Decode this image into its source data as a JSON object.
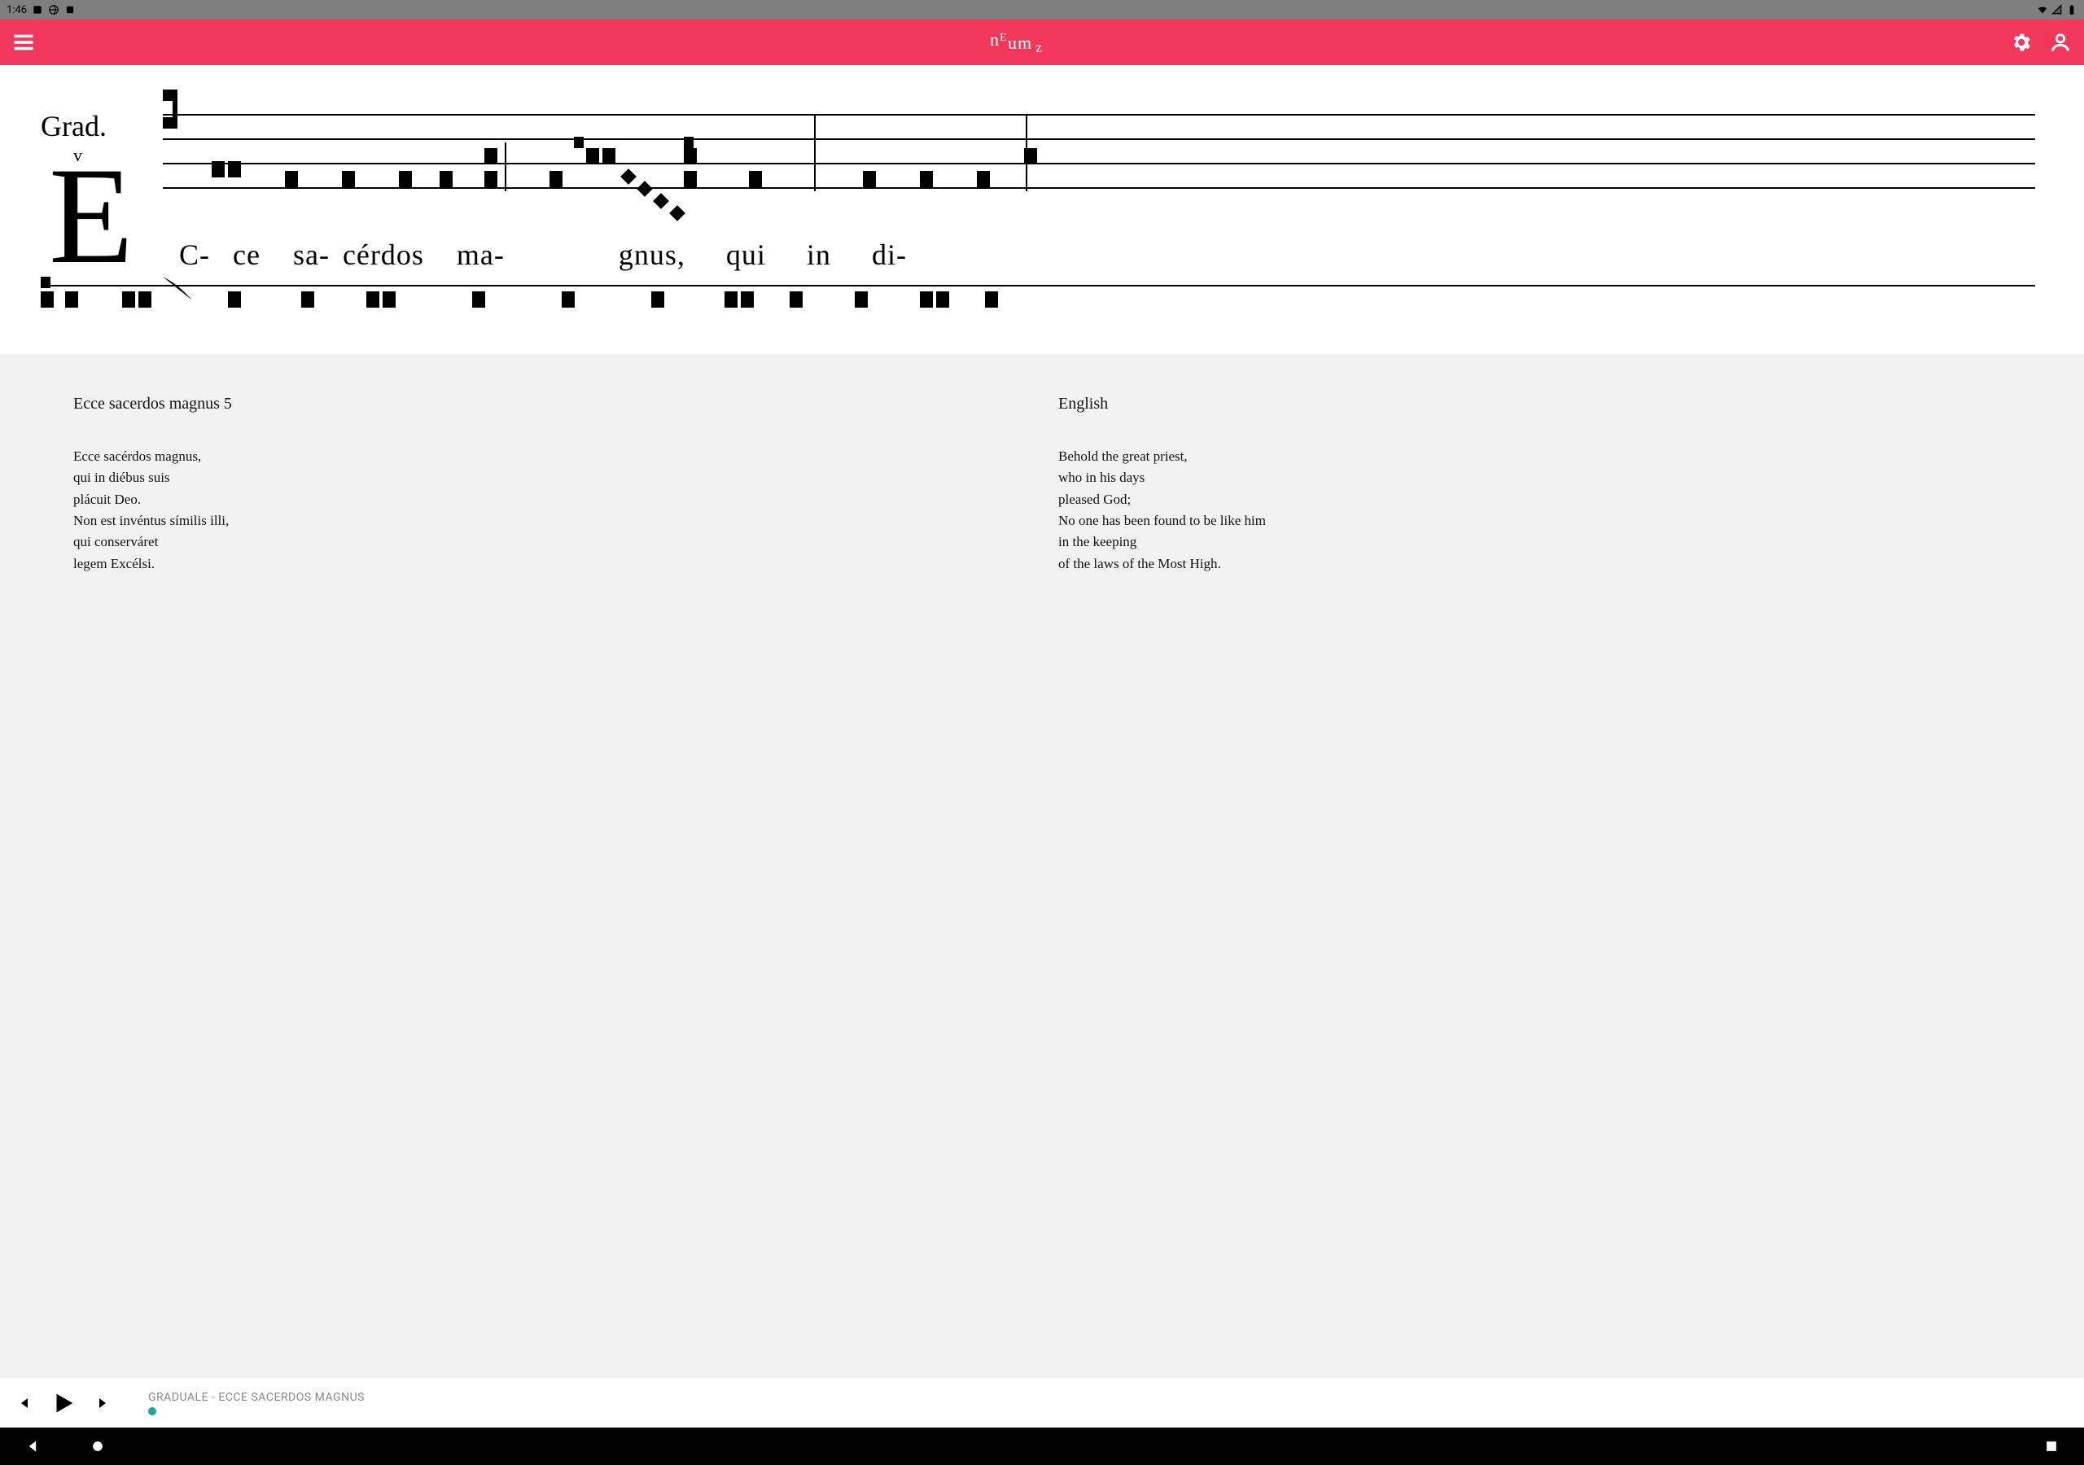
{
  "status": {
    "time": "1:46"
  },
  "header": {
    "logo_text": "neumz"
  },
  "score": {
    "label": "Grad.",
    "mode": "v",
    "initial": "E",
    "syllables": "C- ce  sa- cérdos  ma-         gnus,   qui   in   di-"
  },
  "text": {
    "latin_title": "Ecce sacerdos magnus 5",
    "english_title": "English",
    "latin_lines": [
      "Ecce sacérdos magnus,",
      "qui in diébus suis",
      "plácuit Deo.",
      "Non est invéntus símilis illi,",
      "qui conserváret",
      "legem Excélsi."
    ],
    "english_lines": [
      "Behold the great priest,",
      "who in his days",
      "pleased God;",
      "No one has been found to be like him",
      "in the keeping",
      "of the laws of the Most High."
    ]
  },
  "player": {
    "track_title": "GRADUALE - ECCE SACERDOS MAGNUS"
  }
}
